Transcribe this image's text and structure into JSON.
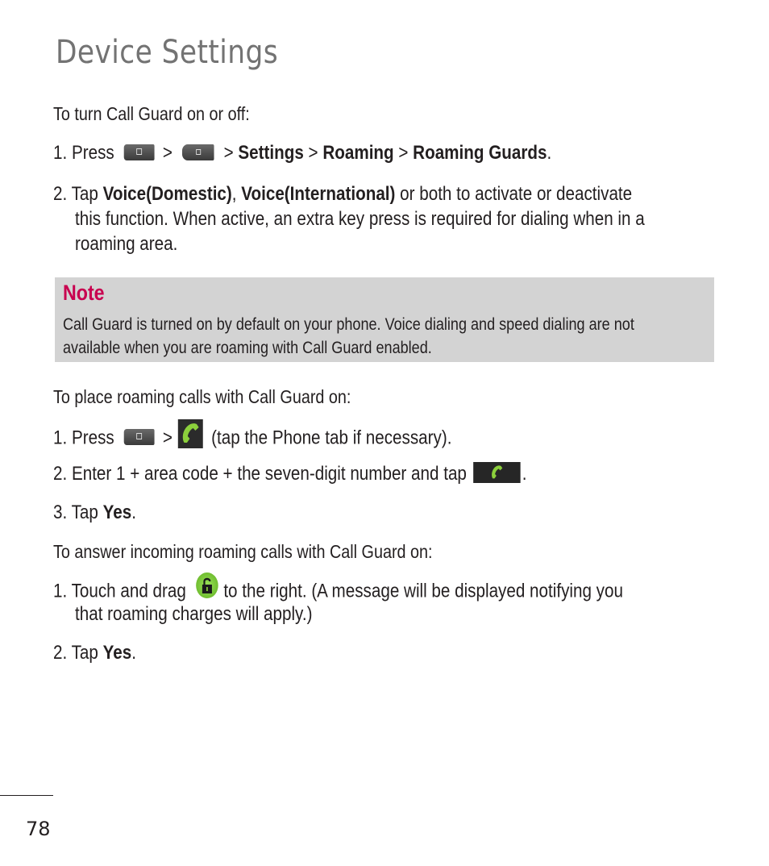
{
  "page": {
    "title": "Device Settings",
    "page_number": "78"
  },
  "section1": {
    "heading": "To turn Call Guard on or off:",
    "step1": {
      "prefix": "1. Press",
      "sep1": ">",
      "sep2": ">",
      "path1": "Settings",
      "sep3": ">",
      "path2": "Roaming",
      "sep4": ">",
      "path3": "Roaming Guards",
      "end": "."
    },
    "step2": {
      "prefix": "2. Tap",
      "opt1": "Voice(Domestic)",
      "comma": ",",
      "opt2": "Voice(International)",
      "rest": "or both to activate or deactivate",
      "line2": "this function. When active, an extra key press is required for dialing when in a",
      "line3": "roaming area."
    }
  },
  "note": {
    "title": "Note",
    "line1": "Call Guard is turned on by default on your phone. Voice dialing and speed dialing are not",
    "line2": "available when you are roaming with Call Guard enabled.",
    "title_color": "#c8004f",
    "background": "#d3d3d3"
  },
  "section2": {
    "heading": "To place roaming calls with Call Guard on:",
    "step1": {
      "prefix": "1. Press",
      "sep": ">",
      "rest": "(tap the Phone tab if necessary)."
    },
    "step2": {
      "text": "2. Enter 1 + area code + the seven-digit number and tap",
      "end": "."
    },
    "step3": {
      "prefix": "3. Tap",
      "bold": "Yes",
      "end": "."
    }
  },
  "section3": {
    "heading": "To answer incoming roaming calls with Call Guard on:",
    "step1": {
      "prefix": "1. Touch and drag",
      "rest": "to the right. (A message will be displayed notifying you",
      "line2": "that roaming charges will apply.)"
    },
    "step2": {
      "prefix": "2. Tap",
      "bold": "Yes",
      "end": "."
    }
  },
  "icons": {
    "home_key": "home-key-icon",
    "menu_key": "menu-key-icon",
    "phone_app": "phone-app-icon",
    "call_button": "call-button-icon",
    "unlock": "unlock-icon",
    "accent_green": "#8cd03c"
  }
}
